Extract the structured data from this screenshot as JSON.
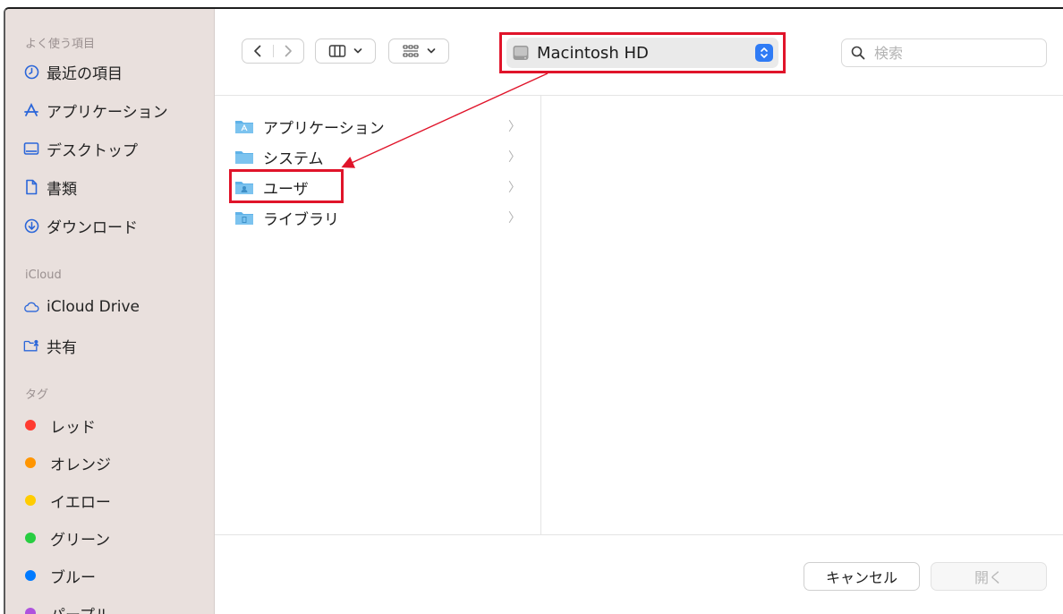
{
  "sidebar": {
    "sections": {
      "favorites": "よく使う項目",
      "icloud": "iCloud",
      "tags": "タグ"
    },
    "favorites": [
      {
        "label": "最近の項目",
        "icon": "clock-icon"
      },
      {
        "label": "アプリケーション",
        "icon": "apps-icon"
      },
      {
        "label": "デスクトップ",
        "icon": "desktop-icon"
      },
      {
        "label": "書類",
        "icon": "document-icon"
      },
      {
        "label": "ダウンロード",
        "icon": "download-icon"
      }
    ],
    "icloud_items": [
      {
        "label": "iCloud Drive",
        "icon": "cloud-icon"
      },
      {
        "label": "共有",
        "icon": "shared-folder-icon"
      }
    ],
    "tags": [
      {
        "label": "レッド",
        "color": "#ff3b30"
      },
      {
        "label": "オレンジ",
        "color": "#ff9500"
      },
      {
        "label": "イエロー",
        "color": "#ffcc00"
      },
      {
        "label": "グリーン",
        "color": "#28cd41"
      },
      {
        "label": "ブルー",
        "color": "#007aff"
      },
      {
        "label": "パープル",
        "color": "#af52de"
      }
    ]
  },
  "toolbar": {
    "location": "Macintosh HD",
    "search_placeholder": "検索",
    "accent_color": "#2f7bf5"
  },
  "browser": {
    "items": [
      {
        "label": "アプリケーション",
        "icon": "applications-folder-icon"
      },
      {
        "label": "システム",
        "icon": "system-folder-icon"
      },
      {
        "label": "ユーザ",
        "icon": "users-folder-icon"
      },
      {
        "label": "ライブラリ",
        "icon": "library-folder-icon"
      }
    ]
  },
  "footer": {
    "cancel_label": "キャンセル",
    "open_label": "開く"
  },
  "annotation": {
    "highlight_color": "#e0142a"
  }
}
